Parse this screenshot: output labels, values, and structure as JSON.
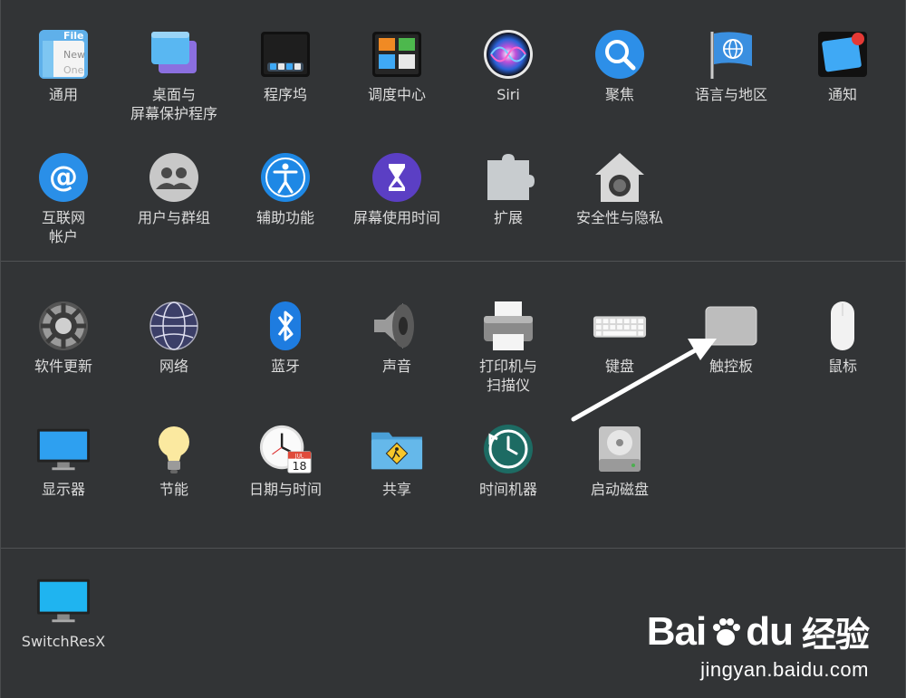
{
  "section1": {
    "items": [
      {
        "label": "通用",
        "icon": "general-icon"
      },
      {
        "label": "桌面与\n屏幕保护程序",
        "icon": "desktop-screensaver-icon"
      },
      {
        "label": "程序坞",
        "icon": "dock-icon"
      },
      {
        "label": "调度中心",
        "icon": "mission-control-icon"
      },
      {
        "label": "Siri",
        "icon": "siri-icon"
      },
      {
        "label": "聚焦",
        "icon": "spotlight-icon"
      },
      {
        "label": "语言与地区",
        "icon": "language-region-icon"
      },
      {
        "label": "通知",
        "icon": "notifications-icon"
      },
      {
        "label": "互联网\n帐户",
        "icon": "internet-accounts-icon"
      },
      {
        "label": "用户与群组",
        "icon": "users-groups-icon"
      },
      {
        "label": "辅助功能",
        "icon": "accessibility-icon"
      },
      {
        "label": "屏幕使用时间",
        "icon": "screen-time-icon"
      },
      {
        "label": "扩展",
        "icon": "extensions-icon"
      },
      {
        "label": "安全性与隐私",
        "icon": "security-privacy-icon"
      }
    ]
  },
  "section2": {
    "items": [
      {
        "label": "软件更新",
        "icon": "software-update-icon"
      },
      {
        "label": "网络",
        "icon": "network-icon"
      },
      {
        "label": "蓝牙",
        "icon": "bluetooth-icon"
      },
      {
        "label": "声音",
        "icon": "sound-icon"
      },
      {
        "label": "打印机与\n扫描仪",
        "icon": "printers-scanners-icon"
      },
      {
        "label": "键盘",
        "icon": "keyboard-icon"
      },
      {
        "label": "触控板",
        "icon": "trackpad-icon"
      },
      {
        "label": "鼠标",
        "icon": "mouse-icon"
      },
      {
        "label": "显示器",
        "icon": "displays-icon"
      },
      {
        "label": "节能",
        "icon": "energy-saver-icon"
      },
      {
        "label": "日期与时间",
        "icon": "date-time-icon"
      },
      {
        "label": "共享",
        "icon": "sharing-icon"
      },
      {
        "label": "时间机器",
        "icon": "time-machine-icon"
      },
      {
        "label": "启动磁盘",
        "icon": "startup-disk-icon"
      }
    ]
  },
  "section3": {
    "items": [
      {
        "label": "SwitchResX",
        "icon": "switchresx-icon"
      }
    ]
  },
  "icon_texts": {
    "general_file": "File",
    "general_new": "New",
    "general_one": "One",
    "calendar_month": "JUL",
    "calendar_day": "18"
  },
  "watermark": {
    "brand": "Bai",
    "brand_end": "du",
    "brand_cn": "经验",
    "url": "jingyan.baidu.com"
  },
  "colors": {
    "background": "#323436",
    "label": "#dcdcdc",
    "accent_blue": "#1e88e5",
    "arrow": "#ffffff"
  }
}
